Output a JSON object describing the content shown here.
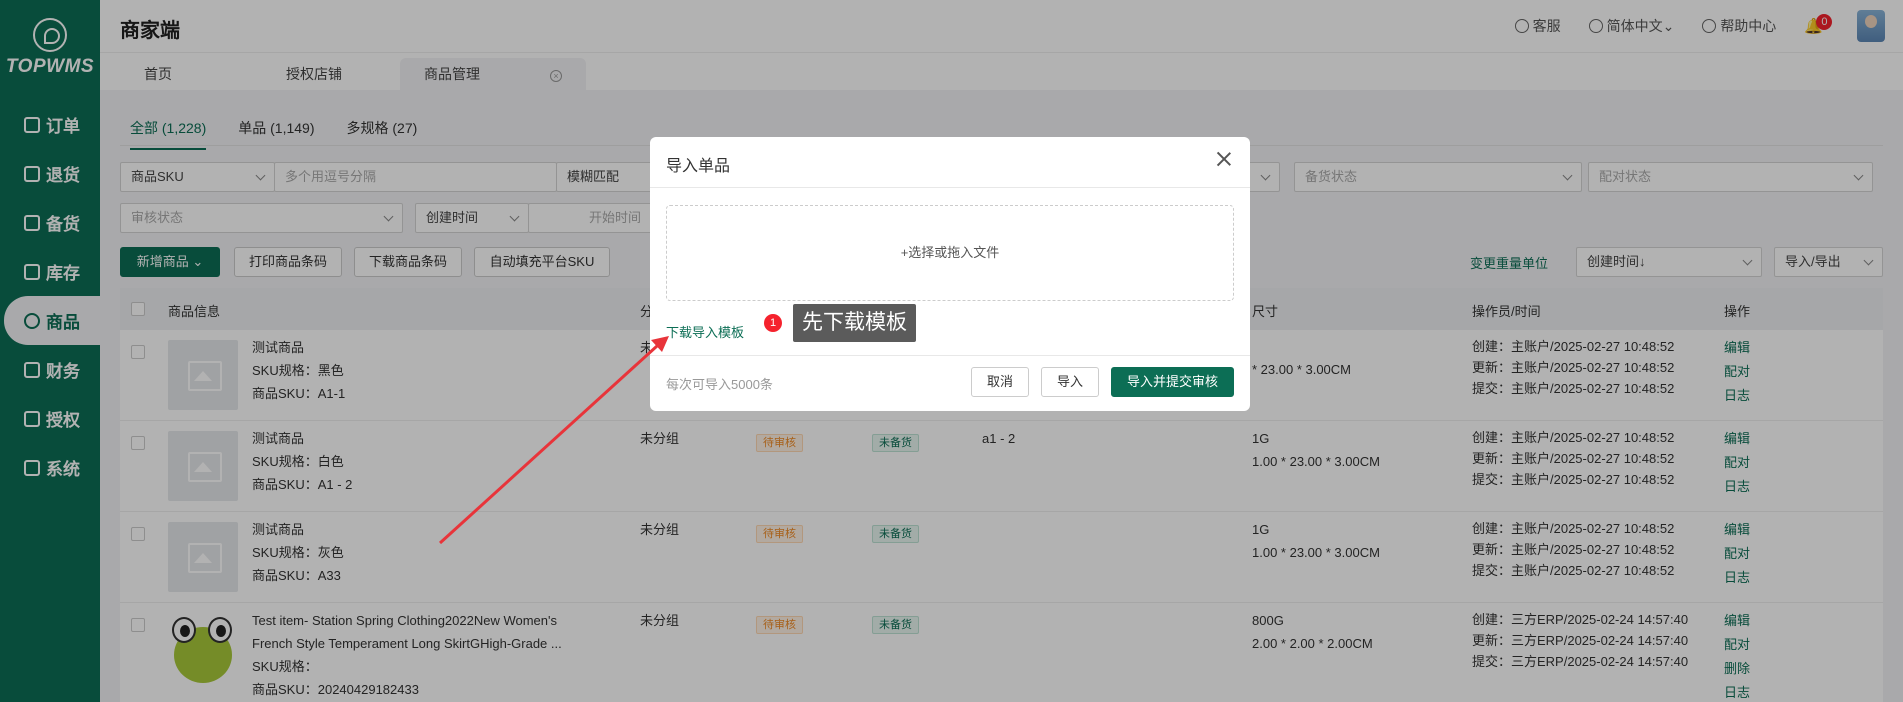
{
  "brand": {
    "logo_text": "TOPWMS",
    "app_title": "商家端"
  },
  "sidebar": {
    "items": [
      {
        "label": "订单",
        "active": false
      },
      {
        "label": "退货",
        "active": false
      },
      {
        "label": "备货",
        "active": false
      },
      {
        "label": "库存",
        "active": false
      },
      {
        "label": "商品",
        "active": true
      },
      {
        "label": "财务",
        "active": false
      },
      {
        "label": "授权",
        "active": false
      },
      {
        "label": "系统",
        "active": false
      }
    ]
  },
  "header": {
    "service": "客服",
    "language": "简体中文",
    "help": "帮助中心",
    "notifications": "0"
  },
  "page_tabs": [
    {
      "label": "首页"
    },
    {
      "label": "授权店铺"
    },
    {
      "label": "商品管理",
      "active": true
    }
  ],
  "sub_tabs": [
    {
      "label": "全部 (1,228)",
      "active": true
    },
    {
      "label": "单品 (1,149)"
    },
    {
      "label": "多规格 (27)"
    }
  ],
  "filters": {
    "sku_type": "商品SKU",
    "sku_placeholder": "多个用逗号分隔",
    "match_mode": "模糊匹配",
    "stock_status_placeholder": "备货状态",
    "match_status_placeholder": "配对状态",
    "audit_status_placeholder": "审核状态",
    "time_type": "创建时间",
    "start_time_placeholder": "开始时间"
  },
  "toolbar": {
    "add_product": "新增商品",
    "print_barcode": "打印商品条码",
    "download_barcode": "下载商品条码",
    "auto_fill_sku": "自动填充平台SKU",
    "change_weight_unit": "变更重量单位",
    "sort": "创建时间↓",
    "import_export": "导入/导出"
  },
  "table": {
    "headers": {
      "info": "商品信息",
      "group": "分",
      "size": "尺寸",
      "operator": "操作员/时间",
      "actions": "操作"
    },
    "rows": [
      {
        "name": "测试商品",
        "spec": "SKU规格：黑色",
        "sku": "商品SKU：A1-1",
        "group": "未",
        "status": "",
        "stock": "",
        "platform_sku": "",
        "weight": "",
        "dims": "* 23.00 * 3.00CM",
        "created": "创建：主账户/2025-02-27 10:48:52",
        "updated": "更新：主账户/2025-02-27 10:48:52",
        "submitted": "提交：主账户/2025-02-27 10:48:52",
        "ops": [
          "编辑",
          "配对",
          "日志"
        ],
        "image": "placeholder"
      },
      {
        "name": "测试商品",
        "spec": "SKU规格：白色",
        "sku": "商品SKU：A1 - 2",
        "group": "未分组",
        "status": "待审核",
        "stock": "未备货",
        "platform_sku": "a1 - 2",
        "weight": "1G",
        "dims": "1.00 * 23.00 * 3.00CM",
        "created": "创建：主账户/2025-02-27 10:48:52",
        "updated": "更新：主账户/2025-02-27 10:48:52",
        "submitted": "提交：主账户/2025-02-27 10:48:52",
        "ops": [
          "编辑",
          "配对",
          "日志"
        ],
        "image": "placeholder"
      },
      {
        "name": "测试商品",
        "spec": "SKU规格：灰色",
        "sku": "商品SKU：A33",
        "group": "未分组",
        "status": "待审核",
        "stock": "未备货",
        "platform_sku": "",
        "weight": "1G",
        "dims": "1.00 * 23.00 * 3.00CM",
        "created": "创建：主账户/2025-02-27 10:48:52",
        "updated": "更新：主账户/2025-02-27 10:48:52",
        "submitted": "提交：主账户/2025-02-27 10:48:52",
        "ops": [
          "编辑",
          "配对",
          "日志"
        ],
        "image": "placeholder"
      },
      {
        "name": "Test item- Station Spring Clothing2022New Women's",
        "name2": "French Style Temperament Long SkirtGHigh-Grade ...",
        "spec": "SKU规格：",
        "sku": "商品SKU：20240429182433",
        "group": "未分组",
        "status": "待审核",
        "stock": "未备货",
        "platform_sku": "",
        "weight": "800G",
        "dims": "2.00 * 2.00 * 2.00CM",
        "created": "创建：三方ERP/2025-02-24 14:57:40",
        "updated": "更新：三方ERP/2025-02-24 14:57:40",
        "submitted": "提交：三方ERP/2025-02-24 14:57:40",
        "ops": [
          "编辑",
          "配对",
          "删除",
          "日志"
        ],
        "image": "frog"
      }
    ]
  },
  "dialog": {
    "title": "导入单品",
    "dropzone": "+选择或拖入文件",
    "download_template": "下载导入模板",
    "note": "每次可导入5000条",
    "cancel": "取消",
    "import": "导入",
    "import_submit": "导入并提交审核"
  },
  "annotation": {
    "number": "1",
    "text": "先下载模板"
  },
  "colors": {
    "brand": "#0c6e55",
    "alert": "#f5222d",
    "annotation_arrow": "#e8343a"
  }
}
